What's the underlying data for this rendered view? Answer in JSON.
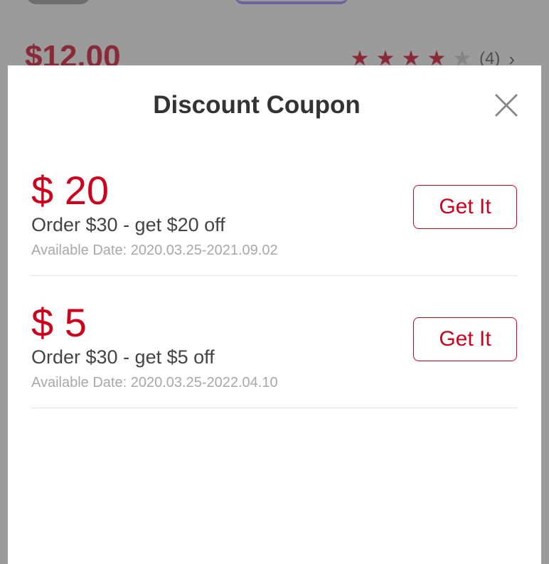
{
  "background": {
    "price": "$12.00",
    "rating": {
      "stars_filled": 4,
      "stars_total": 5,
      "count": "(4)"
    }
  },
  "modal": {
    "title": "Discount Coupon",
    "close_icon": "close-icon",
    "coupons": [
      {
        "amount": "$ 20",
        "description": "Order $30 - get $20 off",
        "available": "Available Date: 2020.03.25-2021.09.02",
        "button_label": "Get It"
      },
      {
        "amount": "$ 5",
        "description": "Order $30 - get $5 off",
        "available": "Available Date: 2020.03.25-2022.04.10",
        "button_label": "Get It"
      }
    ]
  },
  "colors": {
    "accent": "#d0021b",
    "overlay": "#9b9b9b"
  }
}
